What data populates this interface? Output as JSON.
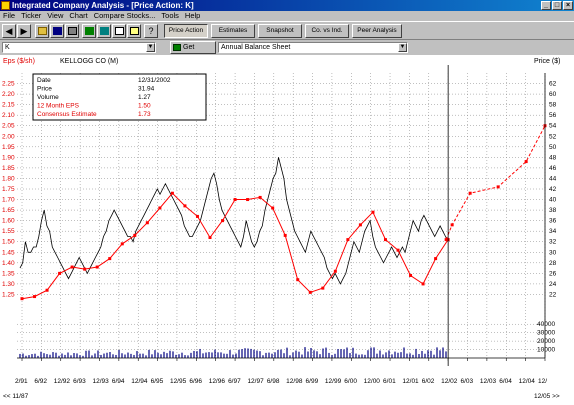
{
  "window": {
    "title": "Integrated Company Analysis - [Price Action:  K]"
  },
  "menu": [
    "File",
    "Ticker",
    "View",
    "Chart",
    "Compare Stocks...",
    "Tools",
    "Help"
  ],
  "toolbar": {
    "tabs": [
      "Price Action",
      "Estimates",
      "Snapshot",
      "Co. vs Ind.",
      "Peer Analysis"
    ],
    "active_tab": "Price Action"
  },
  "address": {
    "ticker": "K",
    "get_report_label": "Get Report",
    "report_type": "Annual Balance Sheet"
  },
  "chart_header": {
    "left_axis_title": "Eps ($/sh)",
    "company": "KELLOGG CO (M)",
    "right_axis_title": "Price ($)"
  },
  "info_box": {
    "rows": [
      {
        "label": "Date",
        "value": "12/31/2002",
        "color": "#000000"
      },
      {
        "label": "Price",
        "value": "31.94",
        "color": "#000000"
      },
      {
        "label": "Volume",
        "value": "1.27",
        "color": "#000000"
      },
      {
        "label": "12 Month EPS",
        "value": "1.50",
        "color": "#e00000"
      },
      {
        "label": "Consensus Estimate",
        "value": "1.73",
        "color": "#e00000"
      }
    ]
  },
  "footer": {
    "left_nav": "<< 11/87",
    "right_nav": "12/05 >>"
  },
  "chart_data": {
    "type": "line",
    "eps_axis": {
      "min": 1.2,
      "max": 2.3,
      "ticks": [
        "1.25",
        "1.30",
        "1.35",
        "1.40",
        "1.45",
        "1.50",
        "1.55",
        "1.60",
        "1.65",
        "1.70",
        "1.75",
        "1.80",
        "1.85",
        "1.90",
        "1.95",
        "2.00",
        "2.05",
        "2.10",
        "2.15",
        "2.20",
        "2.25"
      ]
    },
    "price_axis": {
      "min": 20,
      "max": 64,
      "ticks": [
        "22",
        "24",
        "26",
        "28",
        "30",
        "32",
        "34",
        "36",
        "38",
        "40",
        "42",
        "44",
        "46",
        "48",
        "50",
        "52",
        "54",
        "56",
        "58",
        "60",
        "62"
      ]
    },
    "volume_axis": {
      "max": 45000,
      "ticks": [
        "10000",
        "20000",
        "30000",
        "40000"
      ]
    },
    "x_labels": [
      "2/91",
      "6/92",
      "12/92",
      "6/93",
      "12/93",
      "6/94",
      "12/94",
      "6/95",
      "12/95",
      "6/96",
      "12/96",
      "6/97",
      "12/97",
      "6/98",
      "12/98",
      "6/99",
      "12/99",
      "6/00",
      "12/00",
      "6/01",
      "12/01",
      "6/02",
      "12/02",
      "6/03",
      "12/03",
      "6/04",
      "12/04",
      "12/"
    ],
    "colors": {
      "eps": "#ff0000",
      "price": "#000000",
      "volume": "#000080",
      "grid": "#808080"
    },
    "eps_series": {
      "name": "12 Month EPS",
      "x": [
        "2/91",
        "8/91",
        "2/92",
        "8/92",
        "12/92",
        "6/93",
        "12/93",
        "6/94",
        "12/94",
        "6/95",
        "12/95",
        "6/96",
        "12/96",
        "6/97",
        "12/97",
        "6/98",
        "12/98",
        "6/99",
        "12/99",
        "6/00",
        "12/00",
        "6/01",
        "12/01",
        "6/02",
        "12/02"
      ],
      "values": [
        1.23,
        1.24,
        1.27,
        1.35,
        1.38,
        1.37,
        1.38,
        1.42,
        1.49,
        1.53,
        1.59,
        1.66,
        1.73,
        1.67,
        1.62,
        1.52,
        1.6,
        1.7,
        1.7,
        1.71,
        1.66,
        1.53,
        1.32,
        1.26,
        1.28,
        1.36,
        1.51,
        1.58,
        1.64,
        1.51,
        1.46,
        1.34,
        1.3,
        1.42,
        1.51
      ]
    },
    "estimate_series": {
      "name": "Consensus Estimate",
      "values": [
        1.51,
        1.58,
        1.73,
        1.76,
        1.88,
        2.05
      ]
    },
    "price_series": {
      "name": "Price",
      "values": [
        27,
        28,
        32,
        30,
        30,
        31,
        31,
        33,
        36,
        38,
        35,
        34,
        31,
        30,
        29,
        28,
        27,
        26,
        25,
        26,
        27,
        28,
        29,
        28,
        27,
        26,
        27,
        28,
        29,
        30,
        31,
        33,
        34,
        36,
        37,
        38,
        37,
        36,
        35,
        34,
        33,
        33,
        32,
        34,
        35,
        36,
        37,
        38,
        39,
        40,
        41,
        42,
        41,
        42,
        43,
        42,
        41,
        40,
        39,
        38,
        37,
        35,
        34,
        33,
        33,
        34,
        35,
        36,
        38,
        40,
        42,
        44,
        45,
        43,
        40,
        38,
        37,
        36,
        35,
        34,
        33,
        32,
        31,
        33,
        36,
        34,
        32,
        31,
        32,
        34,
        35,
        38,
        40,
        42,
        44,
        45,
        48,
        46,
        44,
        40,
        38,
        36,
        34,
        33,
        32,
        31,
        30,
        32,
        34,
        33,
        32,
        31,
        30,
        29,
        27,
        26,
        25,
        26,
        25,
        24,
        25,
        26,
        28,
        30,
        32,
        31,
        30,
        32,
        34,
        35,
        36,
        33,
        31,
        30,
        29,
        28,
        29,
        30,
        31,
        30,
        29,
        30,
        31,
        30,
        32,
        34,
        36,
        35,
        34,
        36,
        37,
        36,
        35,
        34,
        33,
        34,
        35,
        34,
        33,
        32
      ]
    },
    "volume_series": {
      "name": "Volume",
      "approx_max": 13000
    }
  }
}
